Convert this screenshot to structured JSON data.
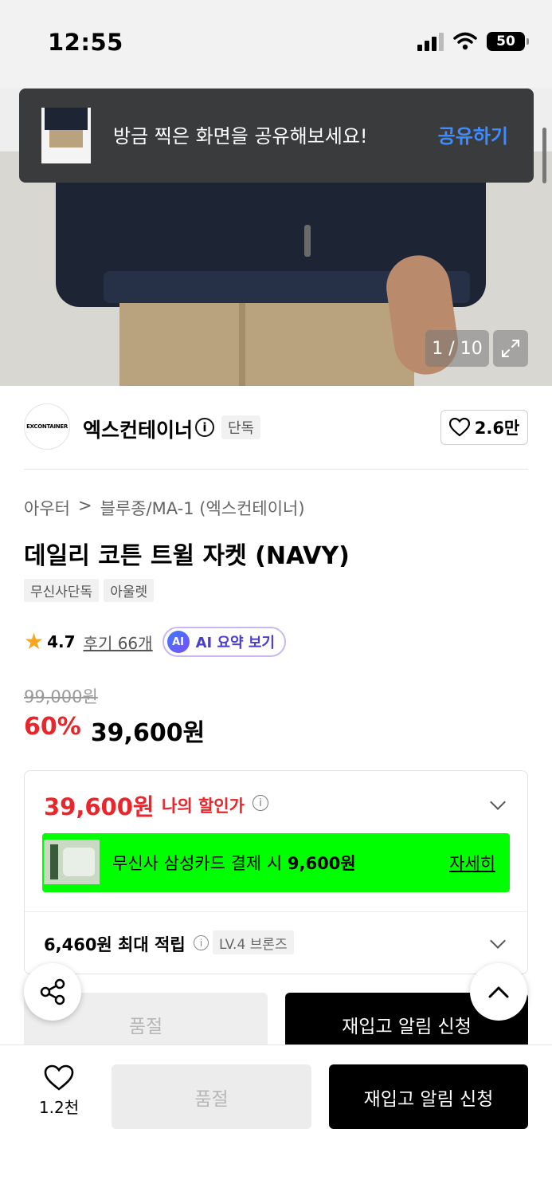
{
  "status_bar": {
    "time": "12:55",
    "battery": "50"
  },
  "toast": {
    "message": "방금 찍은 화면을 공유해보세요!",
    "action": "공유하기"
  },
  "gallery": {
    "counter": "1 / 10"
  },
  "brand": {
    "logo_text": "EXCONTAINER",
    "name": "엑스컨테이너",
    "badge": "단독",
    "likes": "2.6만"
  },
  "breadcrumb": {
    "category": "아우터",
    "separator": ">",
    "subcategory": "블루종/MA-1 (엑스컨테이너)"
  },
  "product": {
    "title": "데일리 코튼 트윌 자켓 (NAVY)",
    "tags": [
      "무신사단독",
      "아울렛"
    ],
    "rating": "4.7",
    "reviews": "후기 66개",
    "ai_badge": "AI",
    "ai_label": "AI 요약 보기",
    "original_price": "99,000원",
    "discount": "60%",
    "sale_price": "39,600원"
  },
  "benefit_card": {
    "my_price": "39,600원",
    "my_price_label": "나의 할인가",
    "promo_text_prefix": "무신사 삼성카드 결제 시 ",
    "promo_amount": "9,600원",
    "promo_link": "자세히",
    "points": "6,460원 최대 적립",
    "level": "LV.4 브론즈"
  },
  "mid_buttons": {
    "soldout": "품절",
    "restock": "재입고 알림 신청"
  },
  "bottom_bar": {
    "like_count": "1.2천",
    "soldout": "품절",
    "restock": "재입고 알림 신청"
  },
  "colors": {
    "accent_red": "#e8262b",
    "promo_green": "#00ff00",
    "link_blue": "#3e8cff"
  },
  "icons": [
    "heart-icon",
    "info-icon",
    "star-icon",
    "share-icon",
    "chevron-up-icon",
    "chevron-down-icon",
    "expand-icon"
  ]
}
